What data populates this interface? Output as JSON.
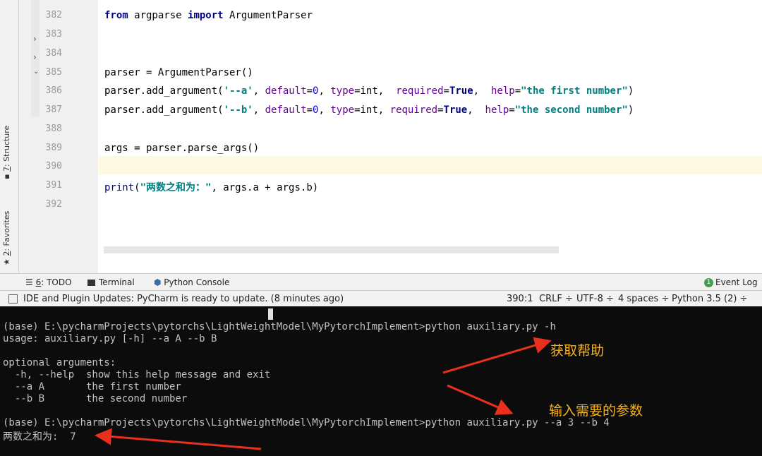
{
  "left_tabs": {
    "structure": {
      "num": "7",
      "label": ": Structure"
    },
    "favorites": {
      "num": "2",
      "label": ": Favorites"
    }
  },
  "editor": {
    "line_numbers": [
      "382",
      "383",
      "384",
      "385",
      "386",
      "387",
      "388",
      "389",
      "390",
      "391",
      "392"
    ],
    "lines": {
      "l382": {
        "kw1": "from",
        "mod": " argparse ",
        "kw2": "import",
        "name": " ArgumentParser"
      },
      "l385": {
        "text": "parser = ArgumentParser()"
      },
      "l386": {
        "p1": "parser.add_argument(",
        "s1": "'--a'",
        "c1": ", ",
        "k1": "default",
        "e1": "=",
        "n1": "0",
        "c2": ", ",
        "k2": "type",
        "e2": "=int,  ",
        "k3": "required",
        "e3": "=",
        "t1": "True",
        "c3": ",  ",
        "k4": "help",
        "e4": "=",
        "s2": "\"the first number\"",
        "p2": ")"
      },
      "l387": {
        "p1": "parser.add_argument(",
        "s1": "'--b'",
        "c1": ", ",
        "k1": "default",
        "e1": "=",
        "n1": "0",
        "c2": ", ",
        "k2": "type",
        "e2": "=int, ",
        "k3": "required",
        "e3": "=",
        "t1": "True",
        "c3": ",  ",
        "k4": "help",
        "e4": "=",
        "s2": "\"the second number\"",
        "p2": ")"
      },
      "l389": {
        "text": "args = parser.parse_args()"
      },
      "l391": {
        "fn": "print",
        "p1": "(",
        "s1": "\"两数之和为：\"",
        "rest": ", args.a + args.b)"
      }
    }
  },
  "toolbar": {
    "todo_num": "6",
    "todo_label": ": TODO",
    "terminal": "Terminal",
    "python_console": "Python Console",
    "event_count": "1",
    "event_log": "Event Log"
  },
  "statusbar": {
    "message": "IDE and Plugin Updates: PyCharm is ready to update. (8 minutes ago)",
    "position": "390:1",
    "line_sep": "CRLF ÷",
    "encoding": "UTF-8 ÷",
    "indent": "4 spaces ÷",
    "interpreter": "Python 3.5 (2) ÷"
  },
  "terminal": {
    "lines": [
      "(base) E:\\pycharmProjects\\pytorchs\\LightWeightModel\\MyPytorchImplement>python auxiliary.py -h",
      "usage: auxiliary.py [-h] --a A --b B",
      "",
      "optional arguments:",
      "  -h, --help  show this help message and exit",
      "  --a A       the first number",
      "  --b B       the second number",
      "",
      "(base) E:\\pycharmProjects\\pytorchs\\LightWeightModel\\MyPytorchImplement>python auxiliary.py --a 3 --b 4",
      "两数之和为:  7"
    ]
  },
  "annotations": {
    "help": "获取帮助",
    "params": "输入需要的参数"
  },
  "colors": {
    "arrow": "#e8301c",
    "annotation": "#f6b21a"
  }
}
